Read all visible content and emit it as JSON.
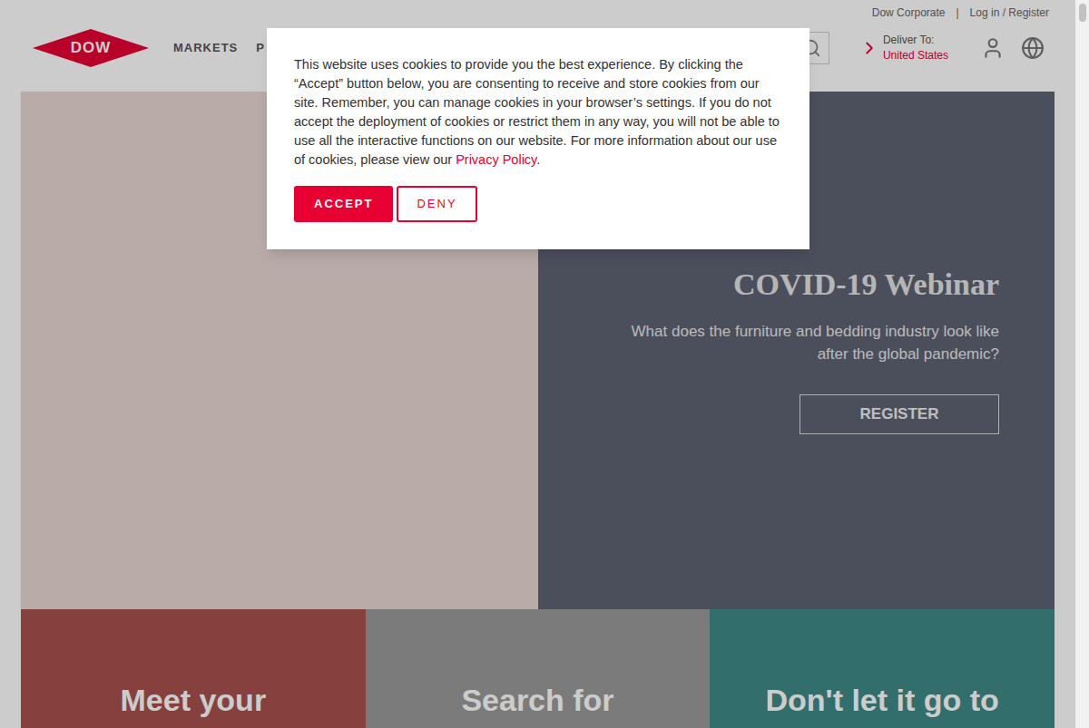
{
  "header": {
    "logo": "DOW",
    "utility_links": [
      "Dow Corporate",
      "Log in / Register"
    ],
    "separator": "|",
    "nav": [
      "MARKETS",
      "P"
    ],
    "deliver_to": {
      "label": "Deliver To:",
      "value": "United States"
    }
  },
  "hero": {
    "title": "COVID-19 Webinar",
    "subtitle": "What does the furniture and bedding industry look like after the global pandemic?",
    "button": "REGISTER"
  },
  "cards": [
    {
      "title": "Meet your",
      "color": "#a8524f"
    },
    {
      "title": "Search for",
      "color": "#9a9a9a"
    },
    {
      "title": "Don't let it go to",
      "color": "#3f8a87"
    }
  ],
  "cookie_dialog": {
    "text": "This website uses cookies to provide you the best experience. By clicking the “Accept” button below, you are consenting to receive and store cookies from our site. Remember, you can manage cookies in your browser’s settings. If you do not accept the deployment of cookies or restrict them in any way, you will not be able to use all the interactive functions on our website. For more information about our use of cookies, please view our ",
    "link": "Privacy Policy",
    "after_link": ".",
    "buttons": [
      {
        "label": "ACCEPT",
        "primary": true
      },
      {
        "label": "DENY",
        "primary": false
      }
    ]
  }
}
